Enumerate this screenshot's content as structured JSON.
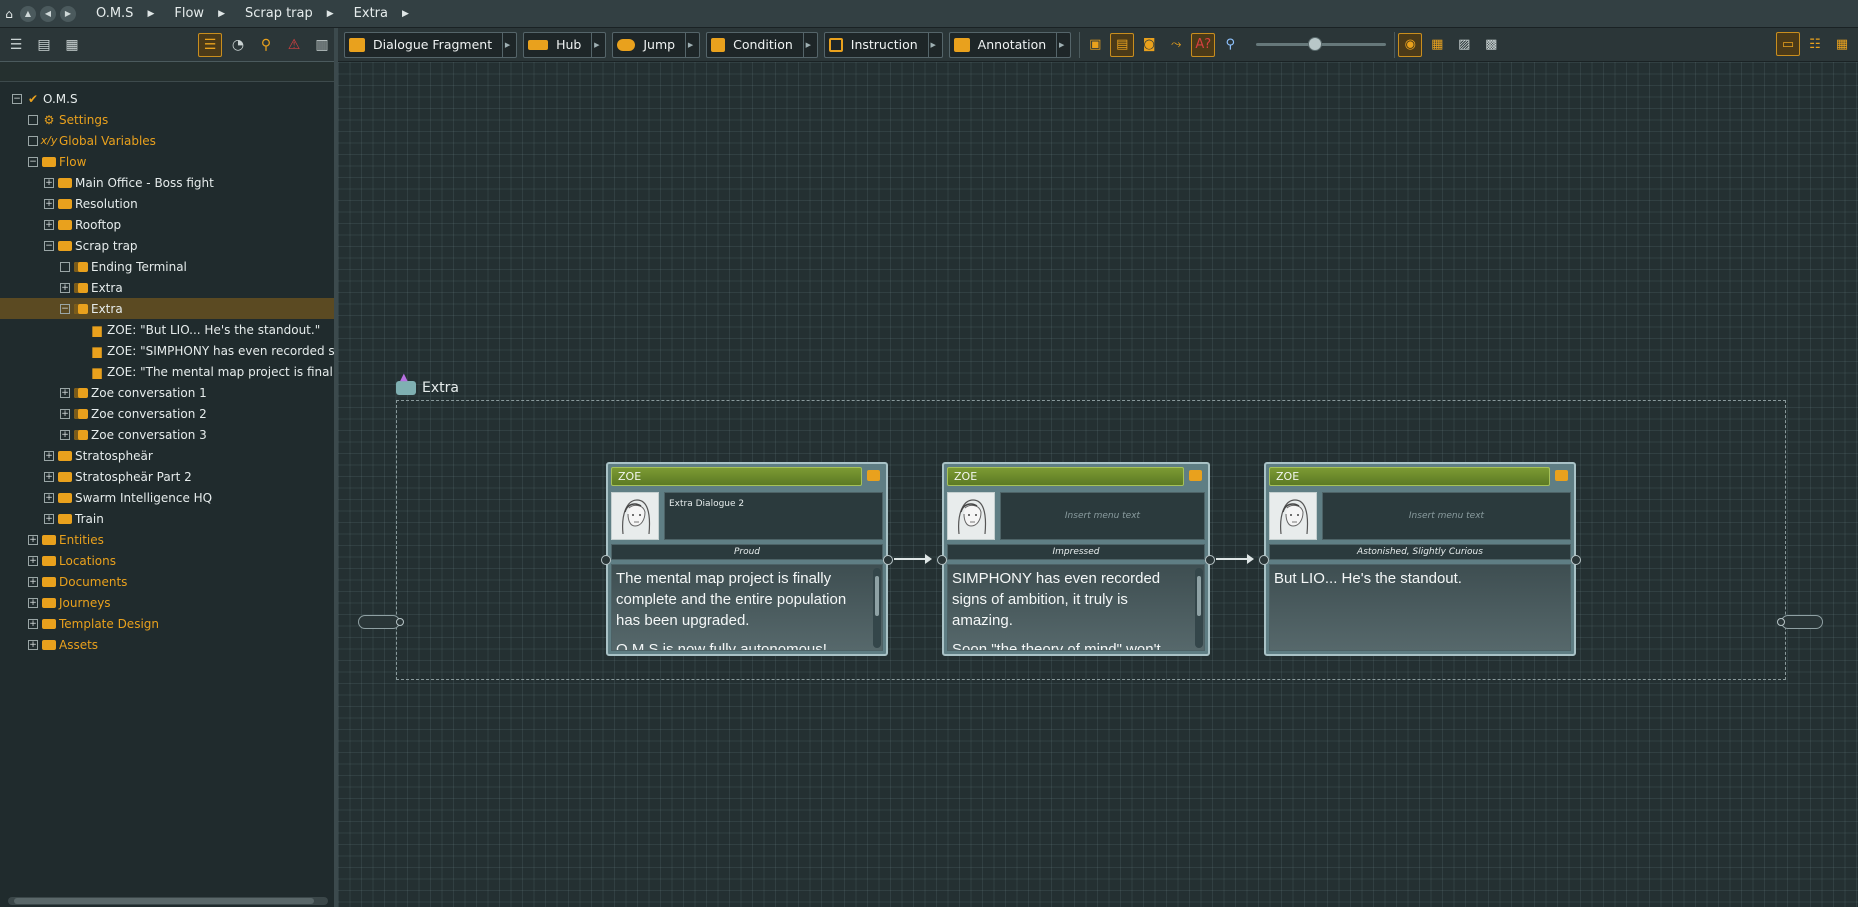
{
  "breadcrumb": [
    "O.M.S",
    "Flow",
    "Scrap trap",
    "Extra"
  ],
  "tree": [
    {
      "label": "O.M.S",
      "level": 0,
      "expander": "−",
      "icon": "check",
      "orange": false
    },
    {
      "label": "Settings",
      "level": 1,
      "expander": "",
      "icon": "gear",
      "orange": true
    },
    {
      "label": "Global Variables",
      "level": 1,
      "expander": "",
      "icon": "xy",
      "orange": true
    },
    {
      "label": "Flow",
      "level": 1,
      "expander": "−",
      "icon": "folder",
      "orange": true
    },
    {
      "label": "Main Office - Boss fight",
      "level": 2,
      "expander": "+",
      "icon": "folder",
      "orange": false
    },
    {
      "label": "Resolution",
      "level": 2,
      "expander": "+",
      "icon": "folder",
      "orange": false
    },
    {
      "label": "Rooftop",
      "level": 2,
      "expander": "+",
      "icon": "folder",
      "orange": false
    },
    {
      "label": "Scrap trap",
      "level": 2,
      "expander": "−",
      "icon": "folder",
      "orange": false
    },
    {
      "label": "Ending Terminal",
      "level": 3,
      "expander": "",
      "icon": "flowfolder",
      "orange": false
    },
    {
      "label": "Extra",
      "level": 3,
      "expander": "+",
      "icon": "flowfolder",
      "orange": false
    },
    {
      "label": "Extra",
      "level": 3,
      "expander": "−",
      "icon": "flowfolder",
      "orange": false,
      "selected": true
    },
    {
      "label": "ZOE: \"But LIO... He's the standout.\"",
      "level": 4,
      "expander": "none",
      "icon": "speech",
      "orange": false
    },
    {
      "label": "ZOE: \"SIMPHONY has even recorded signs of...",
      "level": 4,
      "expander": "none",
      "icon": "speech",
      "orange": false
    },
    {
      "label": "ZOE: \"The mental map project is finally c...\"",
      "level": 4,
      "expander": "none",
      "icon": "speech",
      "orange": false
    },
    {
      "label": "Zoe conversation 1",
      "level": 3,
      "expander": "+",
      "icon": "flowfolder",
      "orange": false
    },
    {
      "label": "Zoe conversation 2",
      "level": 3,
      "expander": "+",
      "icon": "flowfolder",
      "orange": false
    },
    {
      "label": "Zoe conversation 3",
      "level": 3,
      "expander": "+",
      "icon": "flowfolder",
      "orange": false
    },
    {
      "label": "Stratospheär",
      "level": 2,
      "expander": "+",
      "icon": "folder",
      "orange": false
    },
    {
      "label": "Stratospheär Part 2",
      "level": 2,
      "expander": "+",
      "icon": "folder",
      "orange": false
    },
    {
      "label": "Swarm Intelligence HQ",
      "level": 2,
      "expander": "+",
      "icon": "folder",
      "orange": false
    },
    {
      "label": "Train",
      "level": 2,
      "expander": "+",
      "icon": "folder",
      "orange": false
    },
    {
      "label": "Entities",
      "level": 1,
      "expander": "+",
      "icon": "folder",
      "orange": true
    },
    {
      "label": "Locations",
      "level": 1,
      "expander": "+",
      "icon": "folder",
      "orange": true
    },
    {
      "label": "Documents",
      "level": 1,
      "expander": "+",
      "icon": "doc",
      "orange": true
    },
    {
      "label": "Journeys",
      "level": 1,
      "expander": "+",
      "icon": "folder",
      "orange": true
    },
    {
      "label": "Template Design",
      "level": 1,
      "expander": "+",
      "icon": "doc",
      "orange": true
    },
    {
      "label": "Assets",
      "level": 1,
      "expander": "+",
      "icon": "doc",
      "orange": true
    }
  ],
  "toolbar": {
    "dialogue_fragment": "Dialogue Fragment",
    "hub": "Hub",
    "jump": "Jump",
    "condition": "Condition",
    "instruction": "Instruction",
    "annotation": "Annotation"
  },
  "canvas": {
    "container_title": "Extra",
    "nodes": [
      {
        "speaker": "ZOE",
        "menu_text": "Extra Dialogue 2",
        "menu_placeholder": false,
        "stage": "Proud",
        "text": [
          "The mental map project is finally complete and the entire population has been upgraded.",
          "O.M.S is now fully autonomous!"
        ],
        "scroll": true
      },
      {
        "speaker": "ZOE",
        "menu_text": "Insert menu text",
        "menu_placeholder": true,
        "stage": "Impressed",
        "text": [
          "SIMPHONY has even recorded signs of ambition, it truly is amazing.",
          "Soon \"the theory of mind\" won't"
        ],
        "scroll": true
      },
      {
        "speaker": "ZOE",
        "menu_text": "Insert menu text",
        "menu_placeholder": true,
        "stage": "Astonished, Slightly Curious",
        "text": [
          "But LIO... He's the standout."
        ],
        "scroll": false
      }
    ]
  },
  "colors": {
    "accent": "#e9a11d",
    "speaker_header": "#7c9a33",
    "node_body": "#5f7e84",
    "canvas_bg": "#243032"
  }
}
